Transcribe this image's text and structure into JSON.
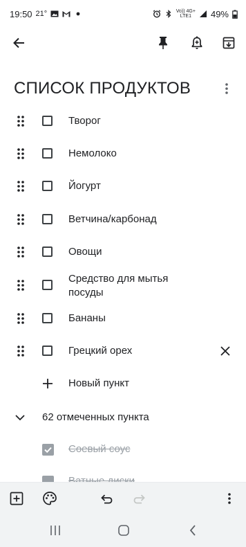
{
  "status": {
    "time": "19:50",
    "temp": "21°",
    "net_top": "Vo)) 4G+",
    "net_bottom": "LTE1",
    "battery": "49%"
  },
  "toolbar": {
    "back_icon": "arrow-left-icon",
    "pin_icon": "pin-icon",
    "reminder_icon": "add-alert-icon",
    "archive_icon": "archive-icon"
  },
  "note": {
    "title": "СПИСОК ПРОДУКТОВ",
    "items": [
      {
        "text": "Творог"
      },
      {
        "text": "Немолоко"
      },
      {
        "text": "Йогурт"
      },
      {
        "text": "Ветчина/карбонад"
      },
      {
        "text": "Овощи"
      },
      {
        "text": "Средство для мытья посуды"
      },
      {
        "text": "Бананы"
      },
      {
        "text": "Грецкий орех"
      }
    ],
    "new_item_label": "Новый пункт",
    "checked_summary": "62 отмеченных пункта",
    "checked_items": [
      {
        "text": "Соевый соус"
      },
      {
        "text": "Ватные диски"
      }
    ]
  },
  "bottom_bar": {
    "icons": [
      "add-box-icon",
      "palette-icon",
      "undo-icon",
      "redo-icon",
      "more-vert-icon"
    ]
  },
  "nav": {
    "icons": [
      "recents-icon",
      "home-icon",
      "back-icon"
    ]
  }
}
